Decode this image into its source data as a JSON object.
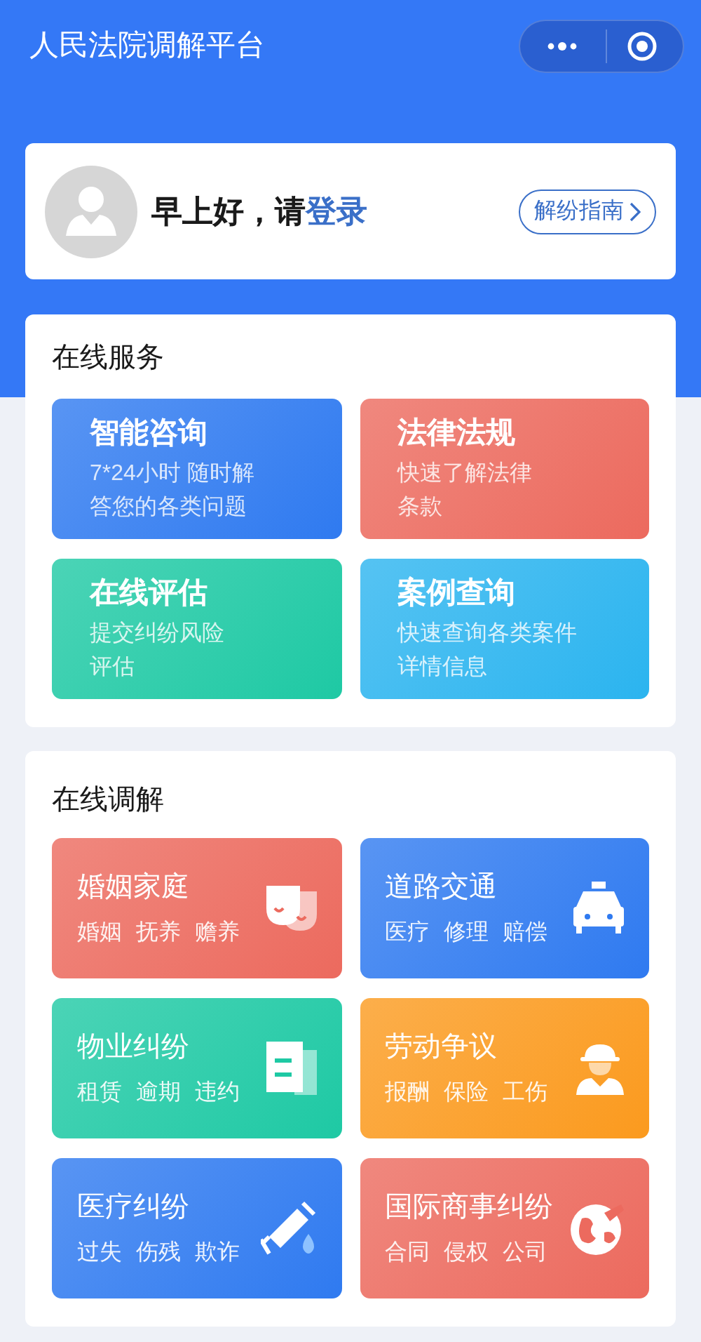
{
  "header": {
    "title": "人民法院调解平台"
  },
  "login_card": {
    "greeting": "早上好，请",
    "login_link": "登录",
    "guide_button": "解纷指南"
  },
  "online_services": {
    "title": "在线服务",
    "tiles": [
      {
        "title": "智能咨询",
        "lines": [
          "7*24小时 随时解",
          "答您的各类问题"
        ],
        "color": "#2f7af0"
      },
      {
        "title": "法律法规",
        "lines": [
          "快速了解法律",
          "条款"
        ],
        "color": "#ec6a5e"
      },
      {
        "title": "在线评估",
        "lines": [
          "提交纠纷风险",
          "评估"
        ],
        "color": "#1ec9a4"
      },
      {
        "title": "案例查询",
        "lines": [
          "快速查询各类案件",
          "详情信息"
        ],
        "color": "#2bb4ef"
      }
    ]
  },
  "online_mediation": {
    "title": "在线调解",
    "tiles": [
      {
        "title": "婚姻家庭",
        "tags": [
          "婚姻",
          "抚养",
          "赡养"
        ],
        "color": "#ec6a5e"
      },
      {
        "title": "道路交通",
        "tags": [
          "医疗",
          "修理",
          "赔偿"
        ],
        "color": "#2f7af0"
      },
      {
        "title": "物业纠纷",
        "tags": [
          "租赁",
          "逾期",
          "违约"
        ],
        "color": "#1ec9a4"
      },
      {
        "title": "劳动争议",
        "tags": [
          "报酬",
          "保险",
          "工伤"
        ],
        "color": "#fb9a1e"
      },
      {
        "title": "医疗纠纷",
        "tags": [
          "过失",
          "伤残",
          "欺诈"
        ],
        "color": "#2f7af0"
      },
      {
        "title": "国际商事纠纷",
        "tags": [
          "合同",
          "侵权",
          "公司"
        ],
        "color": "#ec6a5e"
      }
    ]
  }
}
